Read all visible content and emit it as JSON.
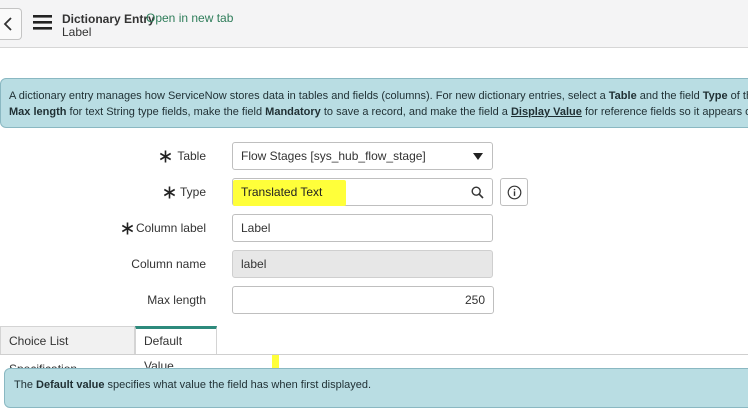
{
  "header": {
    "title": "Dictionary Entry",
    "subtitle": "Label",
    "open_new_tab": "Open in new tab"
  },
  "info_banner": {
    "line1_a": "A dictionary entry manages how ServiceNow stores data in tables and fields (columns). For new dictionary entries, select a ",
    "line1_b": "Table",
    "line1_c": " and the field ",
    "line1_d": "Type",
    "line1_e": " of the",
    "line2_a": "Max length",
    "line2_b": " for text String type fields, make the field ",
    "line2_c": "Mandatory",
    "line2_d": " to save a record, and make the field a ",
    "line2_e": "Display Value",
    "line2_f": " for reference fields so it appears on re"
  },
  "form": {
    "table_label": "Table",
    "table_value": "Flow Stages [sys_hub_flow_stage]",
    "type_label": "Type",
    "type_value": "Translated Text",
    "column_label_label": "Column label",
    "column_label_value": "Label",
    "column_name_label": "Column name",
    "column_name_value": "label",
    "max_length_label": "Max length",
    "max_length_value": "250"
  },
  "tabs": [
    {
      "label": "Choice List Specification",
      "active": false
    },
    {
      "label": "Default Value",
      "active": true
    }
  ],
  "bottom_banner": {
    "pre": "The ",
    "bold": "Default value",
    "post": " specifies what value the field has when first displayed."
  },
  "colors": {
    "highlight": "#ffff3a",
    "banner_bg": "#b9dde3",
    "tab_accent": "#2d8a7c",
    "link": "#2f7d5a"
  }
}
